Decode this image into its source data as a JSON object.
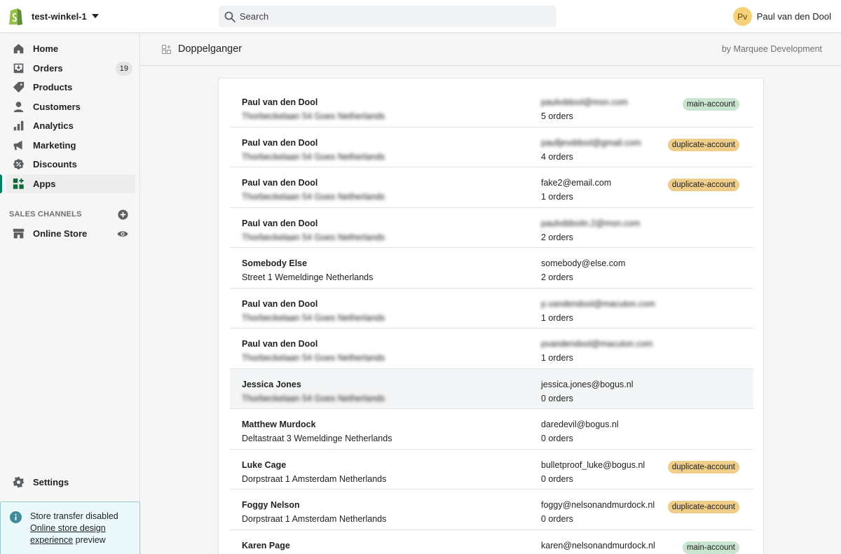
{
  "topbar": {
    "store_name": "test-winkel-1",
    "search_placeholder": "Search",
    "user_initials": "Pv",
    "user_name": "Paul van den Dool"
  },
  "sidebar": {
    "items": [
      {
        "label": "Home",
        "icon": "home-icon"
      },
      {
        "label": "Orders",
        "icon": "orders-icon",
        "badge": "19"
      },
      {
        "label": "Products",
        "icon": "tag-icon"
      },
      {
        "label": "Customers",
        "icon": "person-icon"
      },
      {
        "label": "Analytics",
        "icon": "bar-chart-icon"
      },
      {
        "label": "Marketing",
        "icon": "megaphone-icon"
      },
      {
        "label": "Discounts",
        "icon": "discount-icon"
      },
      {
        "label": "Apps",
        "icon": "apps-icon",
        "active": true
      }
    ],
    "sales_channels_heading": "SALES CHANNELS",
    "online_store_label": "Online Store",
    "settings_label": "Settings",
    "notice": {
      "line1": "Store transfer disabled",
      "link": "Online store design experience",
      "suffix": "preview"
    }
  },
  "app": {
    "title": "Doppelganger",
    "by": "by Marquee Development"
  },
  "customers": [
    {
      "name": "Paul van den Dool",
      "address": "Thorbeckelaan 54 Goes Netherlands",
      "address_blurred": true,
      "email": "paulvddool@msn.com",
      "email_blurred": true,
      "orders": "5 orders",
      "tag": "main-account"
    },
    {
      "name": "Paul van den Dool",
      "address": "Thorbeckelaan 54 Goes Netherlands",
      "address_blurred": true,
      "email": "paulljevddool@gmail.com",
      "email_blurred": true,
      "orders": "4 orders",
      "tag": "duplicate-account"
    },
    {
      "name": "Paul van den Dool",
      "address": "Thorbeckelaan 54 Goes Netherlands",
      "address_blurred": true,
      "email": "fake2@email.com",
      "email_blurred": false,
      "orders": "1 orders",
      "tag": "duplicate-account"
    },
    {
      "name": "Paul van den Dool",
      "address": "Thorbeckelaan 54 Goes Netherlands",
      "address_blurred": true,
      "email": "paulvddooln.2@msn.com",
      "email_blurred": true,
      "orders": "2 orders",
      "tag": ""
    },
    {
      "name": "Somebody Else",
      "address": "Street 1 Wemeldinge Netherlands",
      "address_blurred": false,
      "email": "somebody@else.com",
      "email_blurred": false,
      "orders": "2 orders",
      "tag": ""
    },
    {
      "name": "Paul van den Dool",
      "address": "Thorbeckelaan 54 Goes Netherlands",
      "address_blurred": true,
      "email": "p.vandendool@macuton.com",
      "email_blurred": true,
      "orders": "1 orders",
      "tag": ""
    },
    {
      "name": "Paul van den Dool",
      "address": "Thorbeckelaan 54 Goes Netherlands",
      "address_blurred": true,
      "email": "pvandendool@macuton.com",
      "email_blurred": true,
      "orders": "1 orders",
      "tag": ""
    },
    {
      "name": "Jessica Jones",
      "address": "Thorbeckelaan 54 Goes Netherlands",
      "address_blurred": true,
      "email": "jessica.jones@bogus.nl",
      "email_blurred": false,
      "orders": "0 orders",
      "tag": "",
      "hover": true
    },
    {
      "name": "Matthew Murdock",
      "address": "Deltastraat 3 Wemeldinge Netherlands",
      "address_blurred": false,
      "email": "daredevil@bogus.nl",
      "email_blurred": false,
      "orders": "0 orders",
      "tag": ""
    },
    {
      "name": "Luke Cage",
      "address": "Dorpstraat 1 Amsterdam Netherlands",
      "address_blurred": false,
      "email": "bulletproof_luke@bogus.nl",
      "email_blurred": false,
      "orders": "0 orders",
      "tag": "duplicate-account"
    },
    {
      "name": "Foggy Nelson",
      "address": "Dorpstraat 1 Amsterdam Netherlands",
      "address_blurred": false,
      "email": "foggy@nelsonandmurdock.nl",
      "email_blurred": false,
      "orders": "0 orders",
      "tag": "duplicate-account"
    },
    {
      "name": "Karen Page",
      "address": "",
      "address_blurred": false,
      "email": "karen@nelsonandmurdock.nl",
      "email_blurred": false,
      "orders": "",
      "tag": "main-account"
    }
  ],
  "colors": {
    "brand_green": "#008060",
    "main_tag": "#c9e4cf",
    "duplicate_tag": "#f0cd89",
    "notice_bg": "#ebf9fc"
  }
}
